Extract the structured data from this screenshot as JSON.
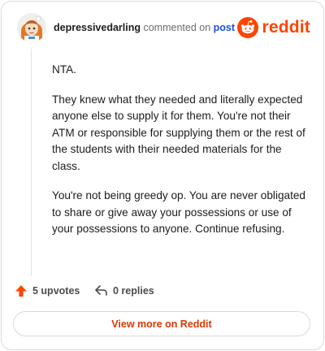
{
  "header": {
    "username": "depressivedarling",
    "action": "commented on",
    "post_link": "post",
    "logo_text": "reddit"
  },
  "comment": {
    "paragraphs": [
      "NTA.",
      "They knew what they needed and literally expected anyone else to supply it for them. You're not their ATM or responsible for supplying them or the rest of the students with their needed materials for the class.",
      "You're not being greedy op. You are never obligated to share or give away your possessions or use of your possessions to anyone. Continue refusing."
    ]
  },
  "footer": {
    "upvotes_label": "5 upvotes",
    "replies_label": "0 replies"
  },
  "view_more_label": "View more on Reddit",
  "colors": {
    "accent": "#ff4500",
    "link": "#1a4fd6",
    "button_text": "#d93900"
  },
  "icons": {
    "vote": "upvote-arrow-icon",
    "reply": "reply-arrow-icon",
    "logo": "reddit-snoo-icon"
  }
}
